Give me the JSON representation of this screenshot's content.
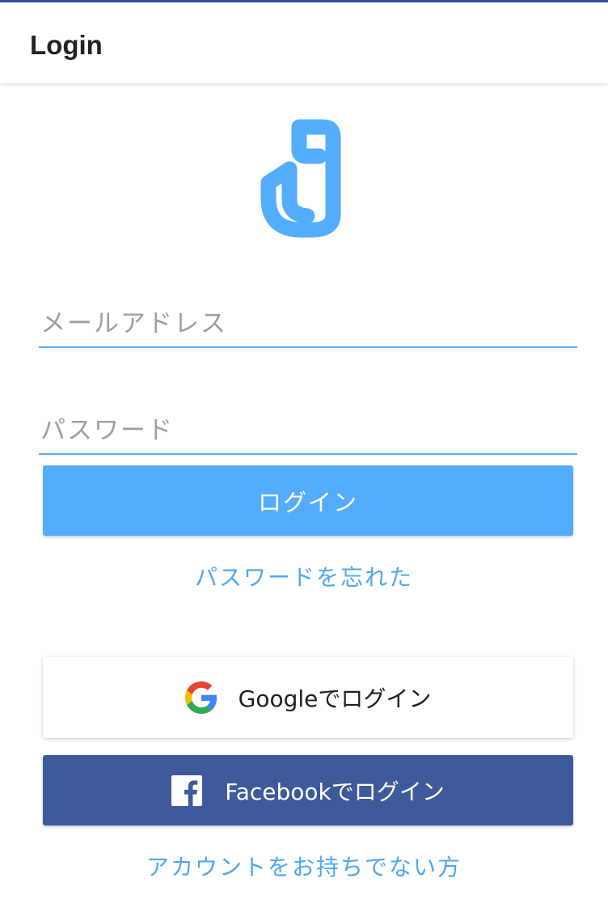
{
  "app_bar": {
    "title": "Login"
  },
  "logo": {
    "icon": "brand-logo-icon",
    "color": "#54acfd"
  },
  "form": {
    "email_placeholder": "メールアドレス",
    "email_value": "",
    "password_placeholder": "パスワード",
    "password_value": "",
    "login_label": "ログイン",
    "forgot_password_label": "パスワードを忘れた"
  },
  "social": {
    "google_label": "Googleでログイン",
    "google_icon": "google-icon",
    "facebook_label": "Facebookでログイン",
    "facebook_icon": "facebook-icon"
  },
  "signup_label": "アカウントをお持ちでない方",
  "colors": {
    "accent": "#54acfd",
    "link": "#4ea8f2",
    "facebook": "#3e5a9a",
    "status_bar": "#3a4fa1"
  }
}
